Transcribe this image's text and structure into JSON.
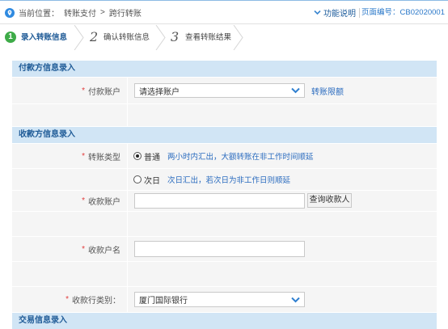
{
  "location": {
    "prefix": "当前位置：",
    "parent": "转账支付",
    "separator": ">",
    "current": "跨行转账"
  },
  "help": {
    "label": "功能说明"
  },
  "page_code": "页面编号：CB02020001",
  "steps": [
    {
      "number": "1",
      "label": "录入转账信息"
    },
    {
      "number": "2",
      "label": "确认转账信息"
    },
    {
      "number": "3",
      "label": "查看转账结果"
    }
  ],
  "required_mark": "*",
  "payer": {
    "title": "付款方信息录入",
    "account_label": "付款账户",
    "account_placeholder": "请选择账户",
    "limit_link": "转账限额"
  },
  "payee": {
    "title": "收款方信息录入",
    "transfer_type_label": "转账类型",
    "transfer_types": [
      {
        "label": "普通",
        "note": "两小时内汇出，大额转账在非工作时间顺延",
        "checked": true
      },
      {
        "label": "次日",
        "note": "次日汇出，若次日为非工作日则顺延",
        "checked": false
      }
    ],
    "account_label": "收款账户",
    "account_value": "",
    "query_button": "查询收款人",
    "name_label": "收款户名",
    "name_value": "",
    "bank_type_label": "收款行类别：",
    "bank_type_value": "厦门国际银行"
  },
  "trade": {
    "title": "交易信息录入"
  },
  "icons": {
    "location": "location-pin-icon",
    "help_toggle": "chevron-down-icon",
    "select_arrow": "chevron-down-icon"
  },
  "colors": {
    "accent": "#2a78c9",
    "section_bg": "#d1e5f5",
    "section_text": "#1f5b97",
    "required": "#e23c3c",
    "step_active": "#3eab48",
    "link": "#2b6cbf"
  }
}
